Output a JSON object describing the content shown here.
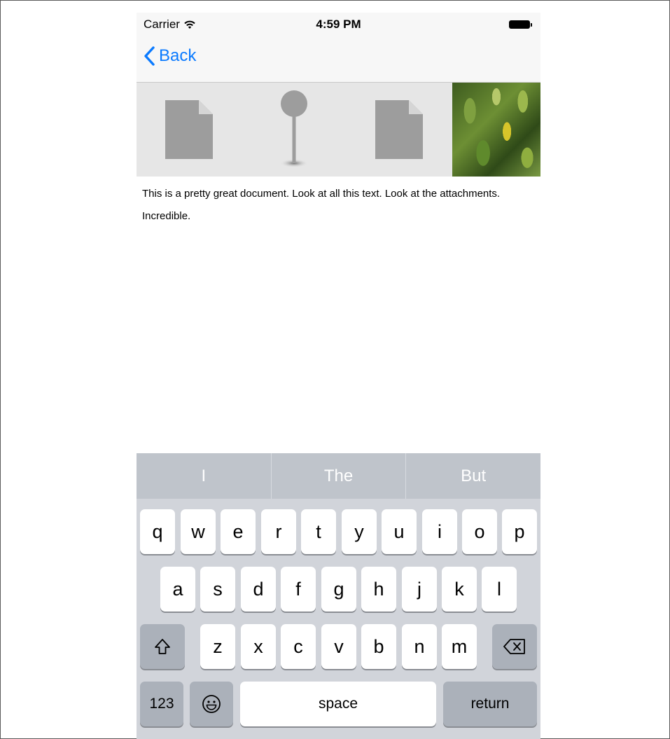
{
  "status_bar": {
    "carrier": "Carrier",
    "time": "4:59 PM"
  },
  "nav": {
    "back_label": "Back"
  },
  "attachments": [
    "document-icon",
    "map-pin-icon",
    "document-icon",
    "leaf-photo"
  ],
  "document": {
    "paragraph1": "This is a pretty great document. Look at all this text. Look at the attachments.",
    "paragraph2": "Incredible."
  },
  "keyboard": {
    "suggestions": [
      "I",
      "The",
      "But"
    ],
    "row1": [
      "q",
      "w",
      "e",
      "r",
      "t",
      "y",
      "u",
      "i",
      "o",
      "p"
    ],
    "row2": [
      "a",
      "s",
      "d",
      "f",
      "g",
      "h",
      "j",
      "k",
      "l"
    ],
    "row3": [
      "z",
      "x",
      "c",
      "v",
      "b",
      "n",
      "m"
    ],
    "numbers_label": "123",
    "space_label": "space",
    "return_label": "return"
  },
  "colors": {
    "accent": "#0a7aff",
    "keyboard_bg": "#d1d4da",
    "suggestion_bar": "#bfc4cb"
  }
}
